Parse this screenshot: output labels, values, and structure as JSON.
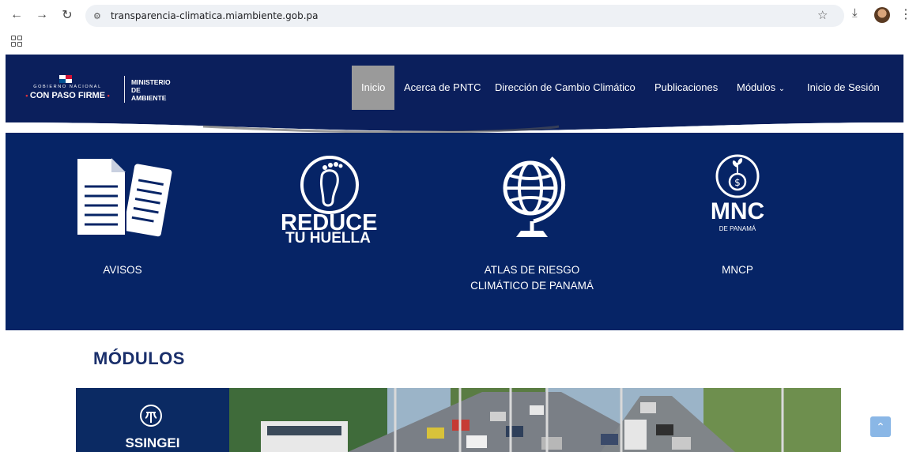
{
  "browser": {
    "url": "transparencia-climatica.miambiente.gob.pa",
    "back_icon": "arrow-left-icon",
    "forward_icon": "arrow-right-icon",
    "reload_icon": "reload-icon"
  },
  "header": {
    "logo_gob": "GOBIERNO NACIONAL",
    "logo_paso": "CON PASO FIRME",
    "logo_ministerio_1": "MINISTERIO DE",
    "logo_ministerio_2": "AMBIENTE",
    "menu": [
      {
        "label": "Inicio",
        "active": true
      },
      {
        "label": "Acerca de PNTC"
      },
      {
        "label": "Dirección de Cambio Climático"
      },
      {
        "label": "Publicaciones"
      },
      {
        "label": "Módulos"
      },
      {
        "label": "Inicio de Sesión"
      }
    ]
  },
  "banner": {
    "tiles": [
      {
        "label": "AVISOS",
        "icon": "documents-icon"
      },
      {
        "label_1": "REDUCE",
        "label_2": "TU HUELLA",
        "icon": "footprint-icon"
      },
      {
        "label_1": "ATLAS DE RIESGO",
        "label_2": "CLIMÁTICO DE PANAMÁ",
        "icon": "globe-icon"
      },
      {
        "big": "MNC",
        "small": "DE PANAMÁ",
        "label": "MNCP",
        "icon": "coin-plant-icon"
      }
    ]
  },
  "modulos": {
    "title": "MÓDULOS",
    "first_module": "SSINGEI"
  },
  "colors": {
    "header_bg": "#0b1f5c",
    "banner_bg": "#062466",
    "title": "#1a2f6b"
  }
}
